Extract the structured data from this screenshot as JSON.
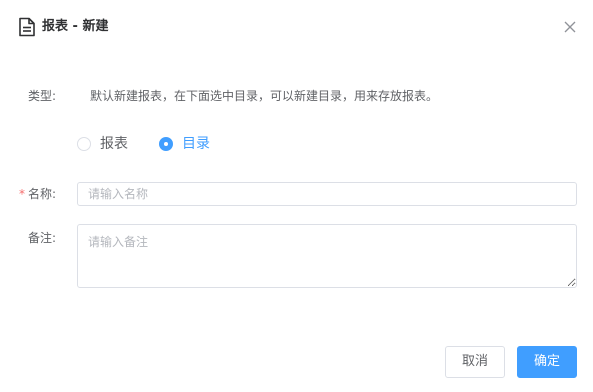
{
  "dialog": {
    "title": "报表 - 新建",
    "title_icon": "document-icon",
    "close_icon": "close-icon"
  },
  "form": {
    "type": {
      "label": "类型:",
      "description": "默认新建报表，在下面选中目录，可以新建目录，用来存放报表。",
      "options": [
        {
          "label": "报表",
          "checked": false
        },
        {
          "label": "目录",
          "checked": true
        }
      ]
    },
    "name": {
      "required_mark": "*",
      "label": "名称:",
      "value": "",
      "placeholder": "请输入名称"
    },
    "remark": {
      "label": "备注:",
      "value": "",
      "placeholder": "请输入备注"
    }
  },
  "footer": {
    "cancel_label": "取消",
    "confirm_label": "确定"
  },
  "colors": {
    "primary": "#409eff",
    "required": "#f56c6c",
    "border": "#dcdfe6",
    "text": "#606266"
  }
}
